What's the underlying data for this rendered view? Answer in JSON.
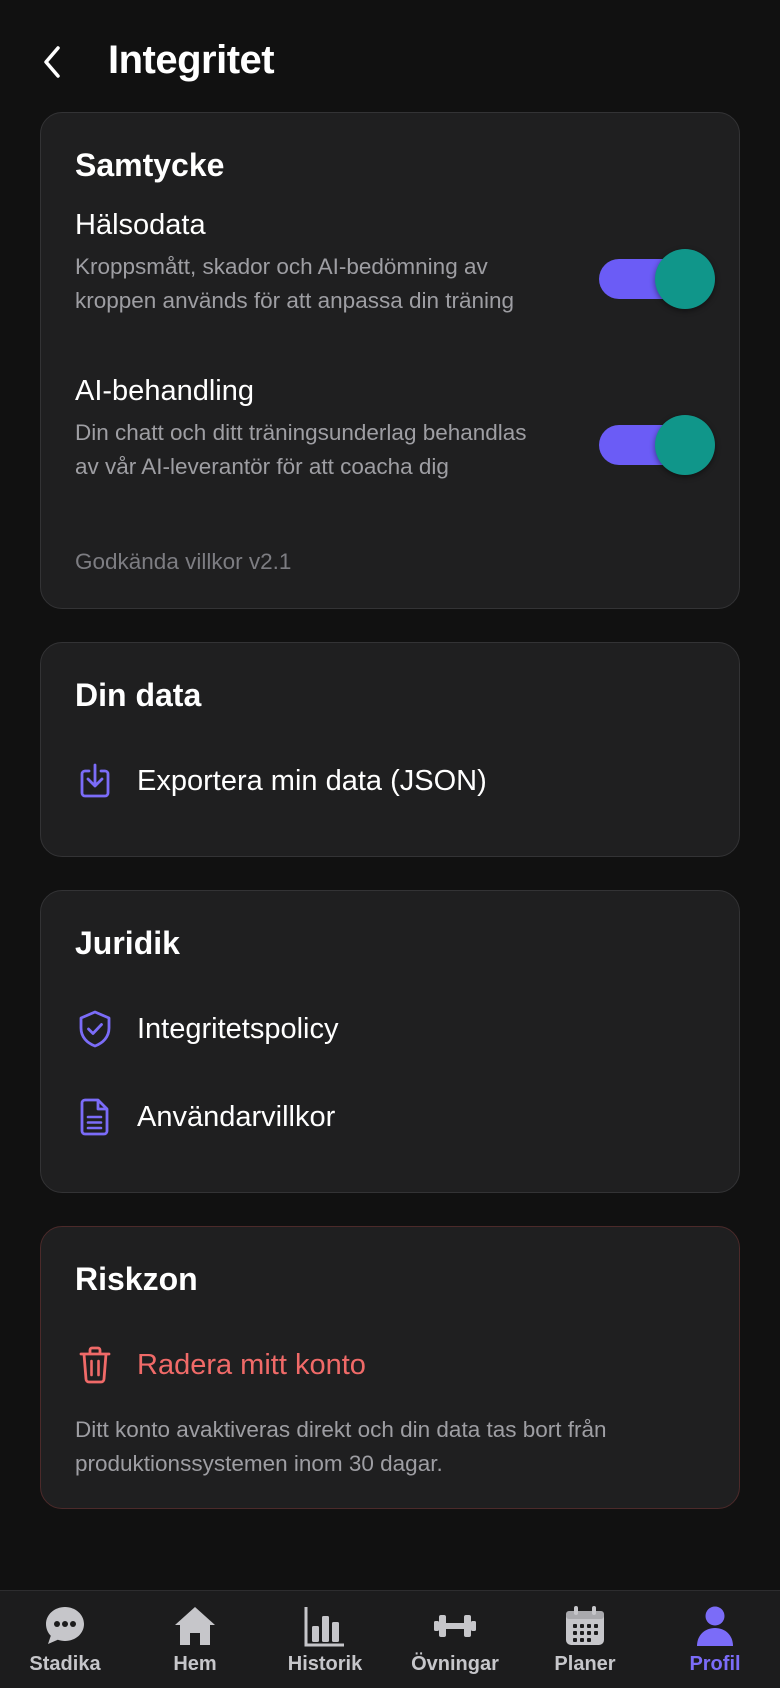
{
  "header": {
    "title": "Integritet"
  },
  "consent": {
    "title": "Samtycke",
    "items": [
      {
        "label": "Hälsodata",
        "description": "Kroppsmått, skador och AI-bedömning av kroppen används för att anpassa din träning",
        "enabled": true
      },
      {
        "label": "AI-behandling",
        "description": "Din chatt och ditt träningsunderlag behandlas av vår AI-leverantör för att coacha dig",
        "enabled": true
      }
    ],
    "terms_note": "Godkända villkor v2.1"
  },
  "data": {
    "title": "Din data",
    "export_label": "Exportera min data (JSON)"
  },
  "legal": {
    "title": "Juridik",
    "privacy_label": "Integritetspolicy",
    "terms_label": "Användarvillkor"
  },
  "danger": {
    "title": "Riskzon",
    "delete_label": "Radera mitt konto",
    "description": "Ditt konto avaktiveras direkt och din data tas bort från produktionssystemen inom 30 dagar."
  },
  "nav": {
    "items": [
      {
        "label": "Stadika",
        "icon": "chat-bubble-icon",
        "active": false
      },
      {
        "label": "Hem",
        "icon": "home-icon",
        "active": false
      },
      {
        "label": "Historik",
        "icon": "bar-chart-icon",
        "active": false
      },
      {
        "label": "Övningar",
        "icon": "dumbbell-icon",
        "active": false
      },
      {
        "label": "Planer",
        "icon": "calendar-icon",
        "active": false
      },
      {
        "label": "Profil",
        "icon": "person-icon",
        "active": true
      }
    ]
  },
  "colors": {
    "background": "#111111",
    "card": "#1f1f20",
    "accent": "#6b5cf6",
    "toggle_knob": "#10968a",
    "danger": "#f06a68",
    "muted_text": "#9e9ea3"
  }
}
